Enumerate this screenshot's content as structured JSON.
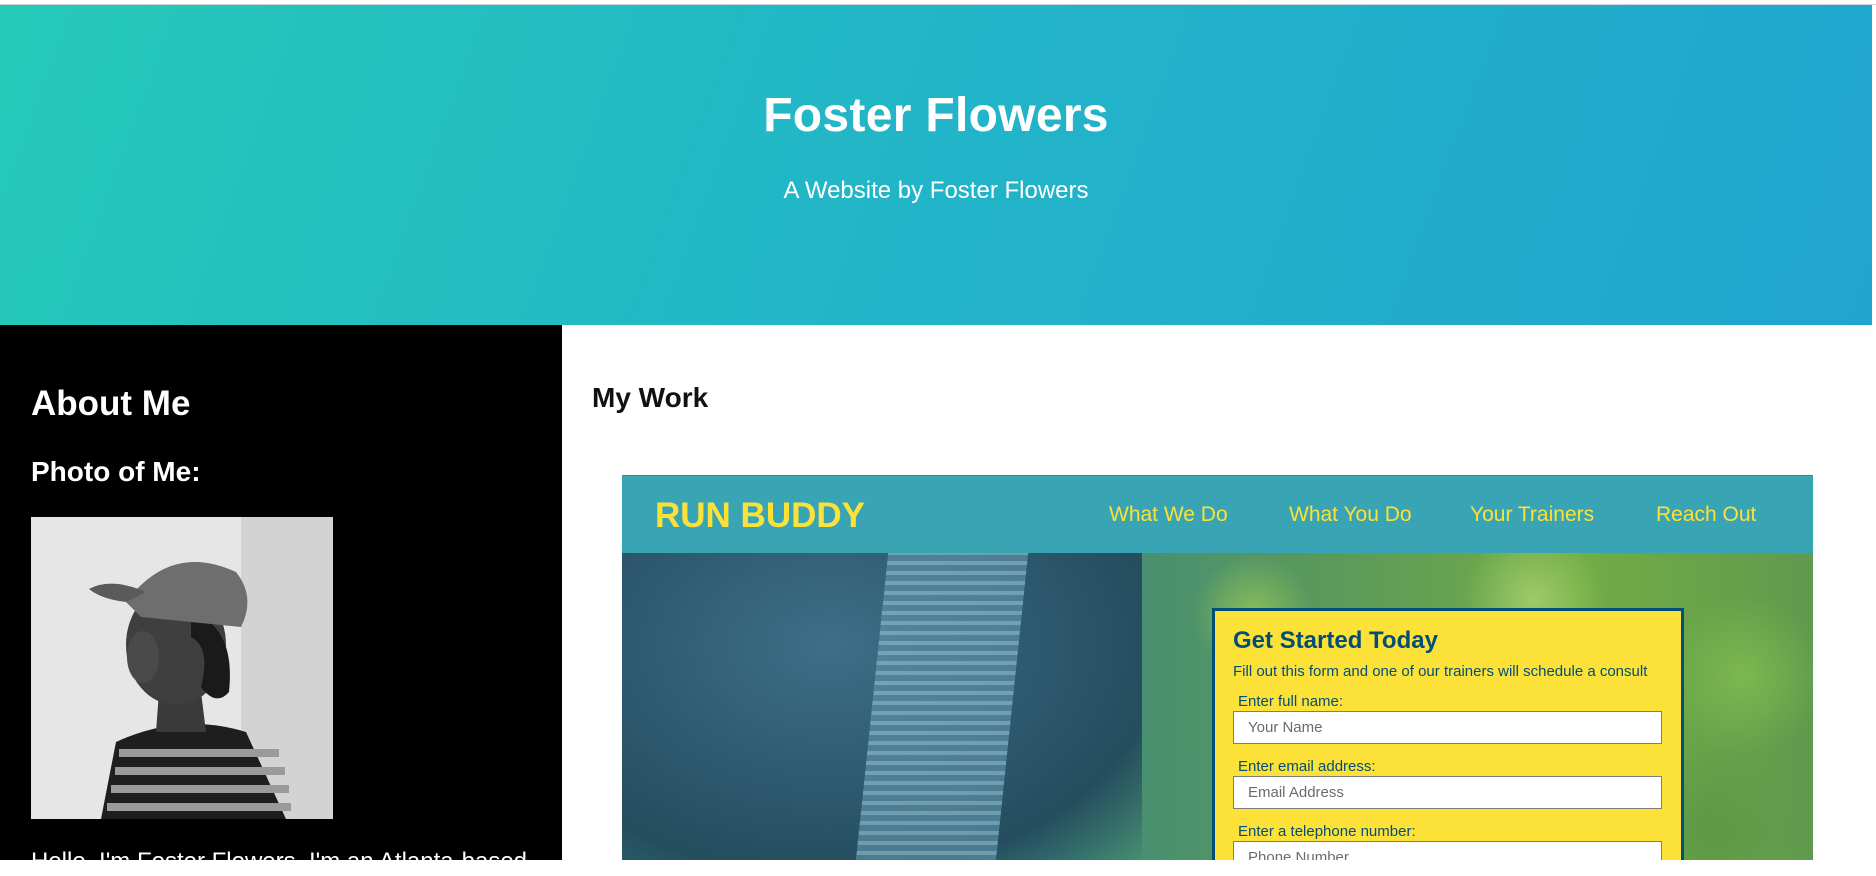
{
  "header": {
    "title": "Foster Flowers",
    "subtitle": "A Website by Foster Flowers"
  },
  "about": {
    "heading": "About Me",
    "photo_heading": "Photo of Me:",
    "bio": "Hello, I'm Foster Flowers. I'm an Atlanta-based"
  },
  "work": {
    "heading": "My Work",
    "project": {
      "logo": "RUN BUDDY",
      "nav": [
        "What We Do",
        "What You Do",
        "Your Trainers",
        "Reach Out"
      ],
      "form": {
        "title": "Get Started Today",
        "intro": "Fill out this form and one of our trainers will schedule a consult",
        "fields": [
          {
            "label": "Enter full name:",
            "placeholder": "Your Name"
          },
          {
            "label": "Enter email address:",
            "placeholder": "Email Address"
          },
          {
            "label": "Enter a telephone number:",
            "placeholder": "Phone Number"
          }
        ]
      }
    }
  },
  "colors": {
    "hero_start": "#26c9b8",
    "hero_end": "#20a5d0",
    "about_bg": "#000000",
    "runbuddy_header": "#39a5b4",
    "runbuddy_yellow": "#fce138",
    "runbuddy_navy": "#024e76"
  }
}
